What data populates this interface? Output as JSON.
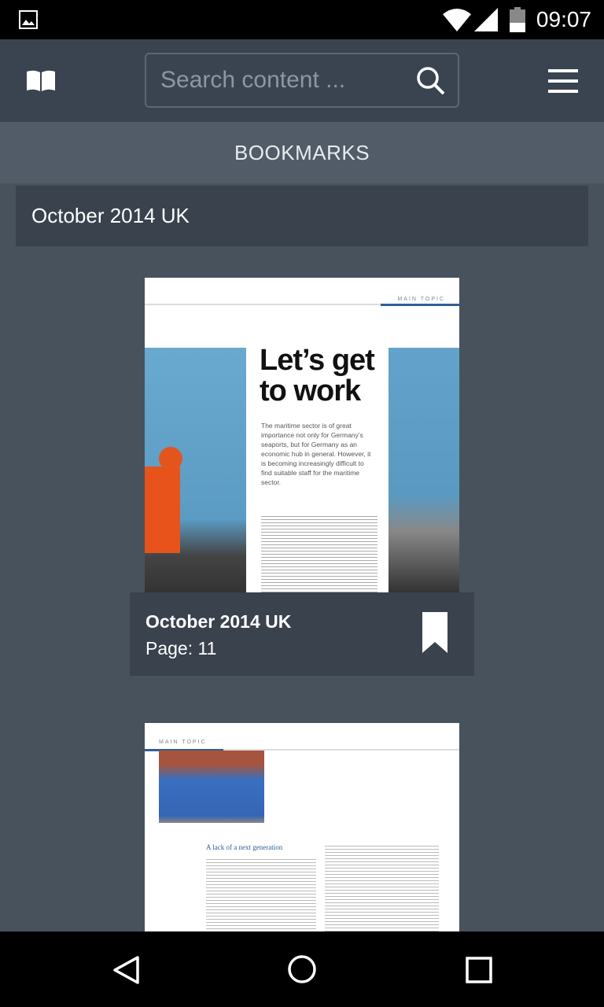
{
  "status_bar": {
    "time": "09:07",
    "icons": [
      "image-icon",
      "wifi-icon",
      "signal-icon",
      "battery-icon"
    ]
  },
  "app_bar": {
    "logo_icon": "open-book-icon",
    "search": {
      "placeholder": "Search content ..."
    },
    "menu_icon": "hamburger-icon"
  },
  "tab": {
    "label": "BOOKMARKS"
  },
  "section": {
    "title": "October 2014 UK"
  },
  "bookmarks": [
    {
      "title": "October 2014 UK",
      "page": "Page: 11",
      "thumb_heading": "Let’s get to work",
      "thumb_label": "MAIN TOPIC",
      "thumb_intro": "The maritime sector is of great importance not only for Germany’s seaports, but for Germany as an economic hub in general. However, it is becoming increasingly difficult to find suitable staff for the maritime sector."
    },
    {
      "thumb_label": "MAIN TOPIC",
      "thumb_heading": "A lack of a next generation"
    }
  ],
  "nav": {
    "back": "back-icon",
    "home": "home-icon",
    "recents": "recents-icon"
  },
  "colors": {
    "appbar": "#3a4450",
    "tabbar": "#515c68",
    "background": "#48525d",
    "card": "#39424d"
  }
}
